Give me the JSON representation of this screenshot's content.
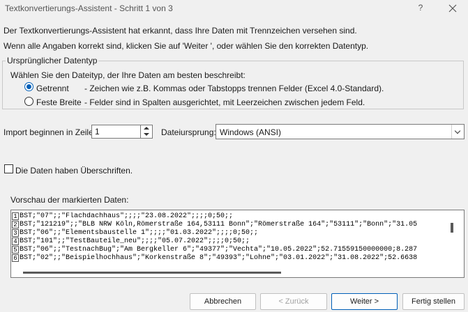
{
  "window": {
    "title": "Textkonvertierungs-Assistent - Schritt 1 von 3",
    "help_label": "?",
    "close_label": "✕"
  },
  "intro": {
    "line1": "Der Textkonvertierungs-Assistent hat erkannt, dass Ihre Daten mit Trennzeichen versehen sind.",
    "line2": "Wenn alle Angaben korrekt sind, klicken Sie auf 'Weiter ', oder wählen Sie den korrekten Datentyp."
  },
  "original_type": {
    "legend": "Ursprünglicher Datentyp",
    "prompt": "Wählen Sie den Dateityp, der Ihre Daten am besten beschreibt:",
    "options": [
      {
        "label": "Getrennt",
        "description": "- Zeichen wie z.B. Kommas oder Tabstopps trennen Felder (Excel 4.0-Standard).",
        "selected": true
      },
      {
        "label": "Feste Breite",
        "description": "- Felder sind in Spalten ausgerichtet, mit Leerzeichen zwischen jedem Feld.",
        "selected": false
      }
    ]
  },
  "import": {
    "start_label": "Import beginnen in Zeile:",
    "start_value": "1",
    "origin_label": "Dateiursprung:",
    "origin_value": "Windows (ANSI)"
  },
  "headers_checkbox": {
    "label": "Die Daten haben Überschriften.",
    "checked": false
  },
  "preview": {
    "label": "Vorschau der markierten Daten:",
    "lines": [
      {
        "num": "1",
        "text": "BST;\"07\";;\"Flachdachhaus\";;;;\"23.08.2022\";;;;0;50;;"
      },
      {
        "num": "2",
        "text": "BST;\"121219\";;\"BLB NRW Köln,Römerstraße 164,53111 Bonn\";\"Römerstraße 164\";\"53111\";\"Bonn\";\"31.05"
      },
      {
        "num": "3",
        "text": "BST;\"06\";;\"Elementsbaustelle 1\";;;;\"01.03.2022\";;;;0;50;;"
      },
      {
        "num": "4",
        "text": "BST;\"101\";;\"TestBauteile_neu\";;;;\"05.07.2022\";;;;0;50;;"
      },
      {
        "num": "5",
        "text": "BST;\"06\";;\"TestnachBug\";\"Am Bergkeller 6\";\"49377\";\"Vechta\";\"10.05.2022\";52.71559150000000;8.287"
      },
      {
        "num": "6",
        "text": "BST;\"02\";;\"Beispielhochhaus\";\"Korkenstraße 8\";\"49393\";\"Lohne\";\"03.01.2022\";\"31.08.2022\";52.6638"
      }
    ]
  },
  "buttons": {
    "cancel": "Abbrechen",
    "back": "< Zurück",
    "next": "Weiter >",
    "finish": "Fertig stellen"
  },
  "colors": {
    "accent": "#005fb8",
    "background": "#f0f0f0"
  }
}
